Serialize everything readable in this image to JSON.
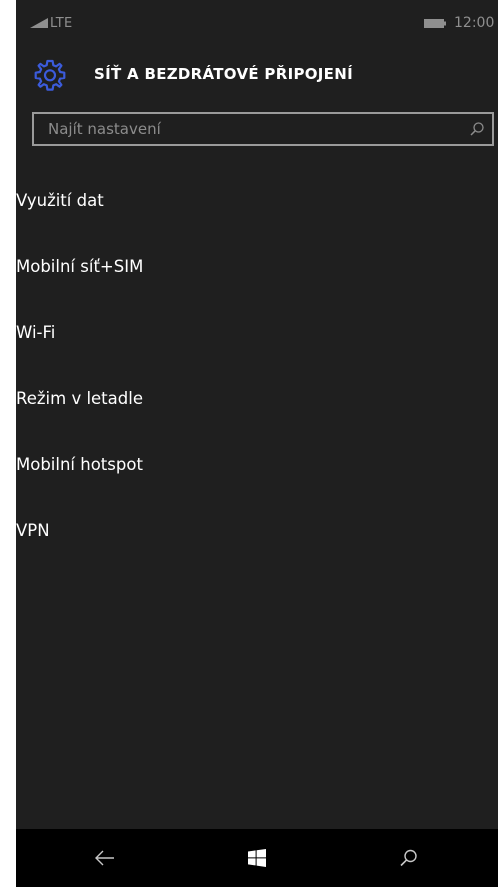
{
  "status_bar": {
    "network": "LTE",
    "time": "12:00",
    "signal_icon": "signal-bars-icon",
    "battery_icon": "battery-icon"
  },
  "header": {
    "icon": "gear-icon",
    "title": "SÍŤ A BEZDRÁTOVÉ PŘIPOJENÍ"
  },
  "search": {
    "placeholder": "Najít nastavení",
    "value": "",
    "icon": "search-icon"
  },
  "menu": {
    "items": [
      {
        "label": "Využití dat"
      },
      {
        "label": "Mobilní síť+SIM"
      },
      {
        "label": "Wi-Fi"
      },
      {
        "label": "Režim v letadle"
      },
      {
        "label": "Mobilní hotspot"
      },
      {
        "label": "VPN"
      }
    ]
  },
  "nav_bar": {
    "back_icon": "back-arrow-icon",
    "start_icon": "windows-logo-icon",
    "search_icon": "search-icon"
  },
  "colors": {
    "background": "#1f1f1f",
    "accent": "#3b5bdb",
    "text": "#ffffff",
    "muted": "#8c8c8c",
    "nav_background": "#000000"
  }
}
